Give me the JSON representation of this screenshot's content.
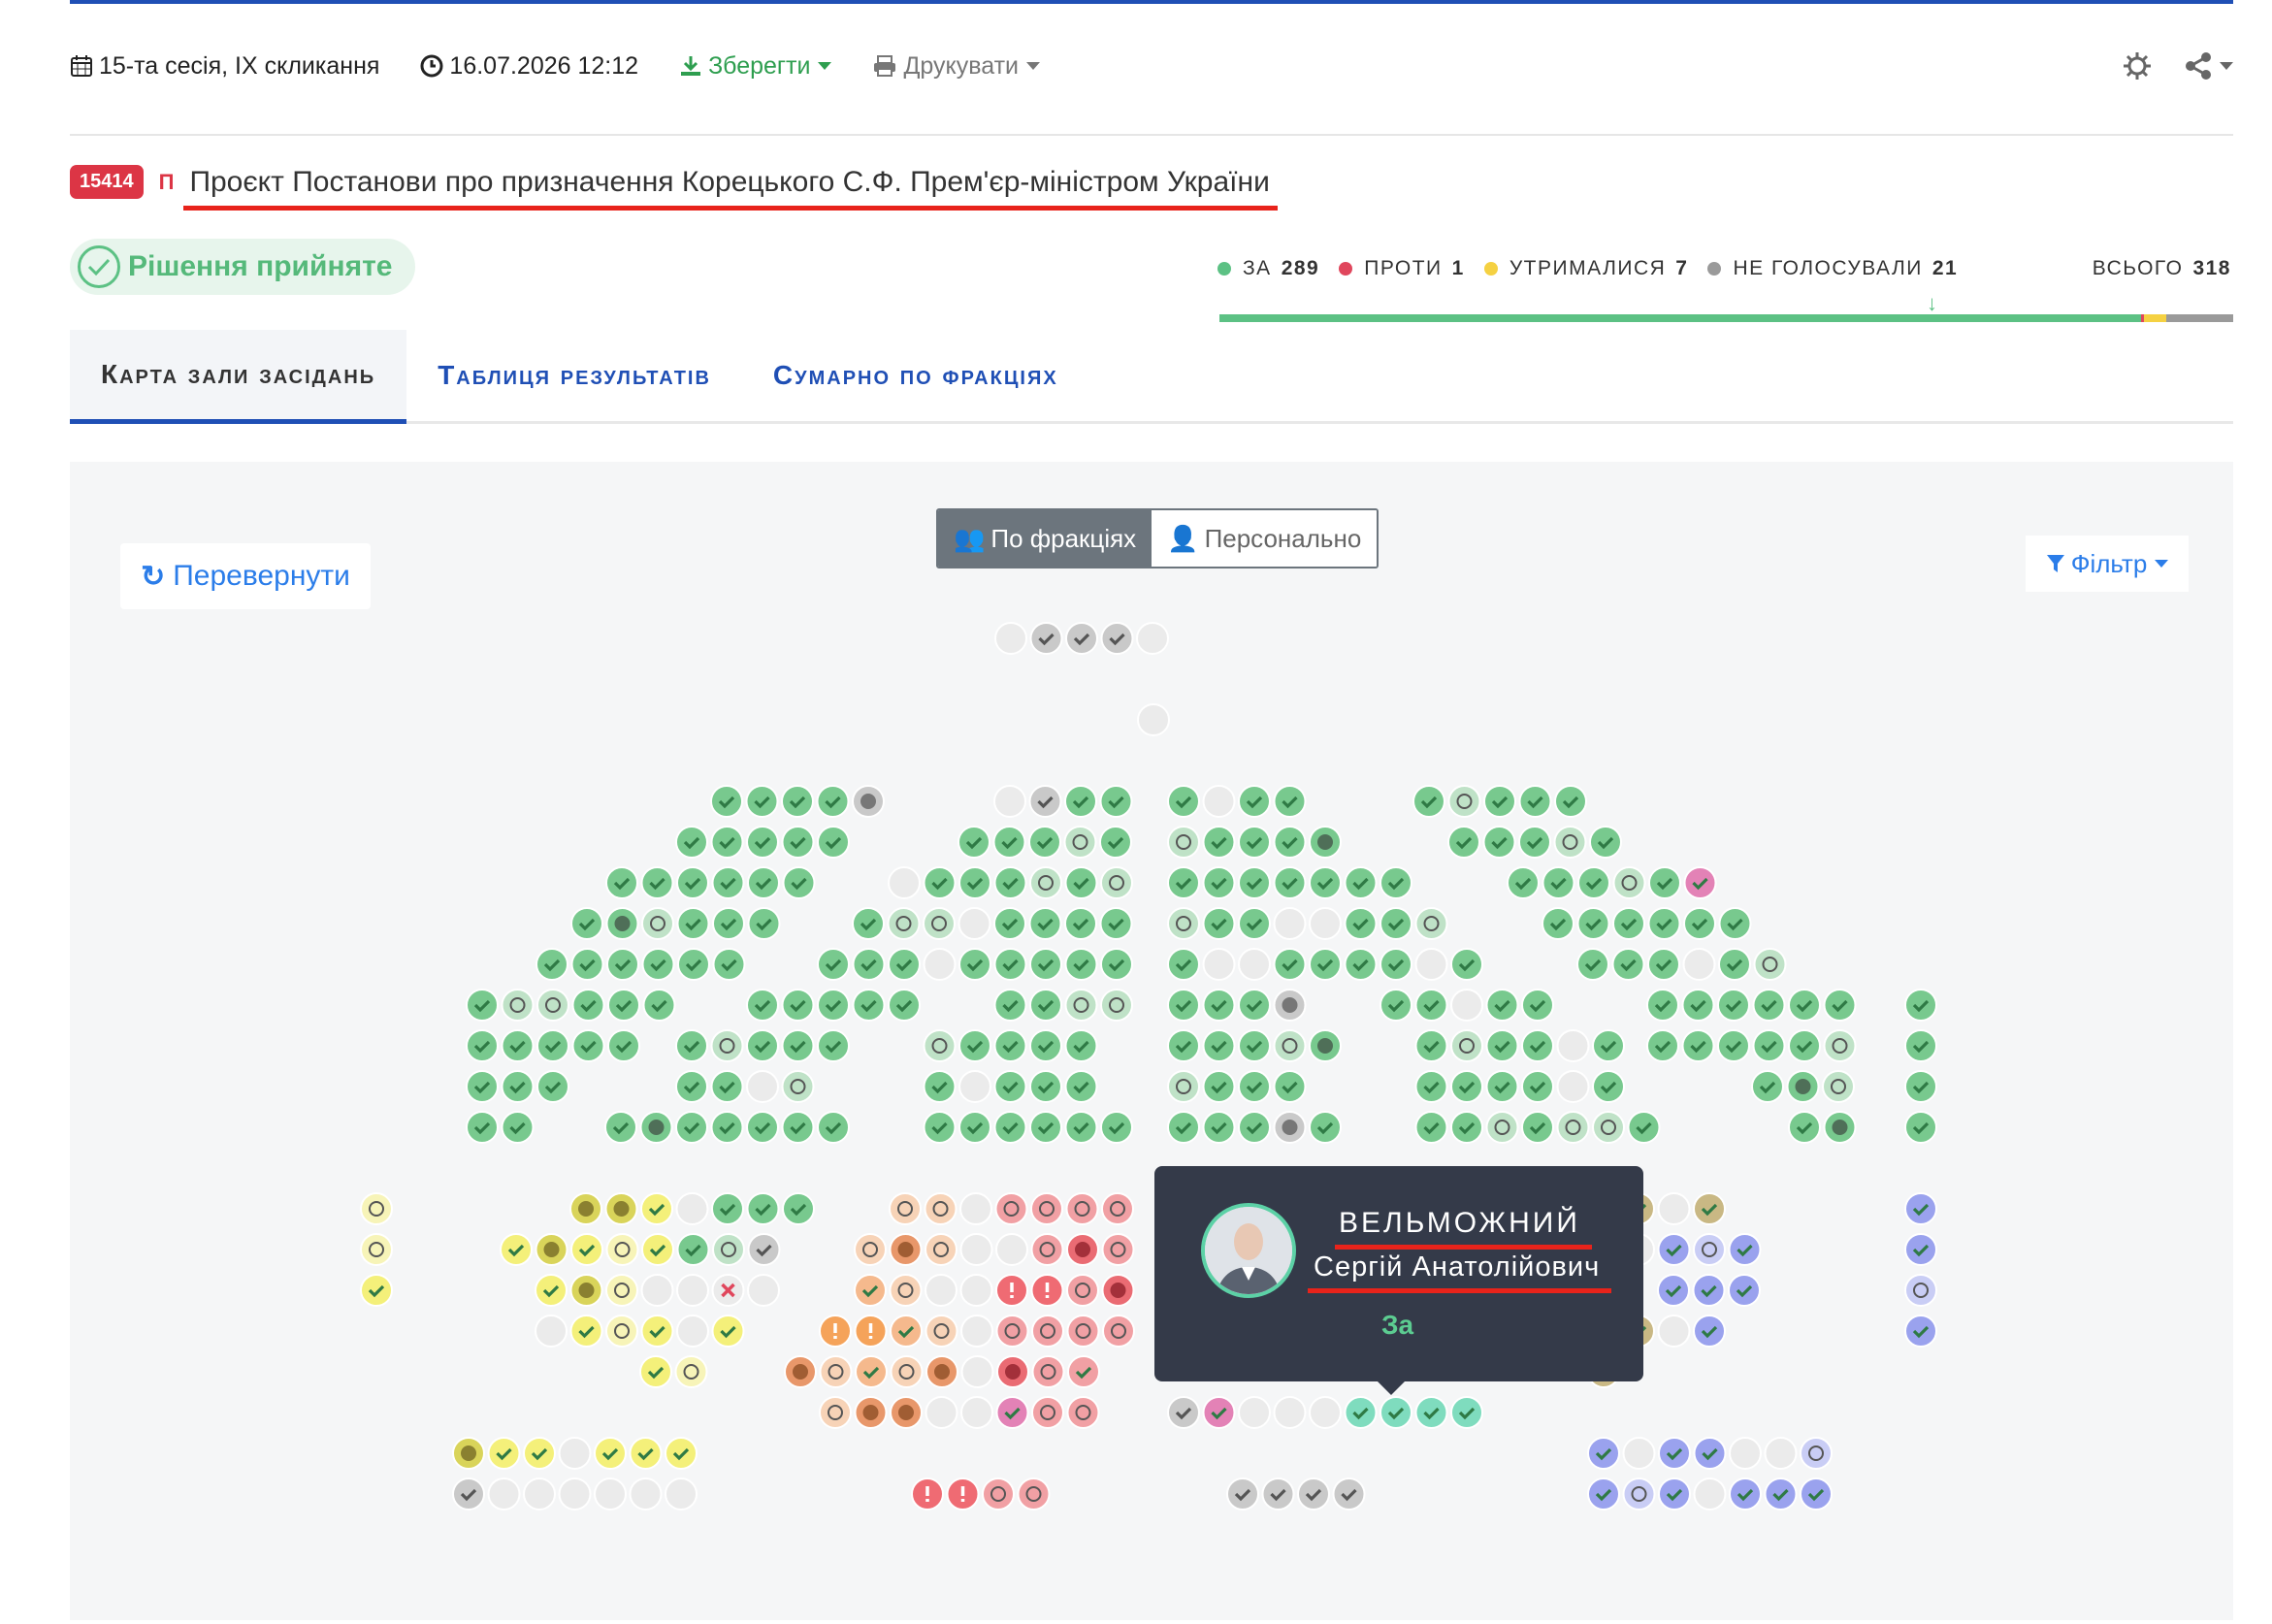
{
  "toolbar": {
    "session": "15-та сесія, IX скликання",
    "datetime": "16.07.2026 12:12",
    "save_label": "Зберегти",
    "print_label": "Друкувати"
  },
  "bill": {
    "id": "15414",
    "type": "П",
    "title": "Проєкт Постанови про призначення Корецького С.Ф. Прем'єр-міністром України"
  },
  "decision": {
    "label": "Рішення прийняте"
  },
  "results": {
    "for_label": "ЗА",
    "for": 289,
    "against_label": "ПРОТИ",
    "against": 1,
    "abstain_label": "УТРИМАЛИСЯ",
    "abstain": 7,
    "not_voted_label": "НЕ ГОЛОСУВАЛИ",
    "not_voted": 21,
    "total_label": "ВСЬОГО",
    "total": 318
  },
  "colors": {
    "accent": "#1f4fb5",
    "danger": "#dc3545",
    "for": "#5cc184",
    "against": "#e0465c",
    "abstain": "#f5c842",
    "not_voted": "#9a9a9a",
    "link": "#2b7de9"
  },
  "tabs": [
    {
      "label": "Карта зали засідань",
      "active": true
    },
    {
      "label": "Таблиця результатів",
      "active": false
    },
    {
      "label": "Сумарно по фракціях",
      "active": false
    }
  ],
  "map": {
    "flip_label": "Перевернути",
    "mode_factions": "По фракціях",
    "mode_personal": "Персонально",
    "filter_label": "Фільтр"
  },
  "tooltip": {
    "last_name": "ВЕЛЬМОЖНИЙ",
    "first_name": "Сергій Анатолійович",
    "vote": "За"
  }
}
